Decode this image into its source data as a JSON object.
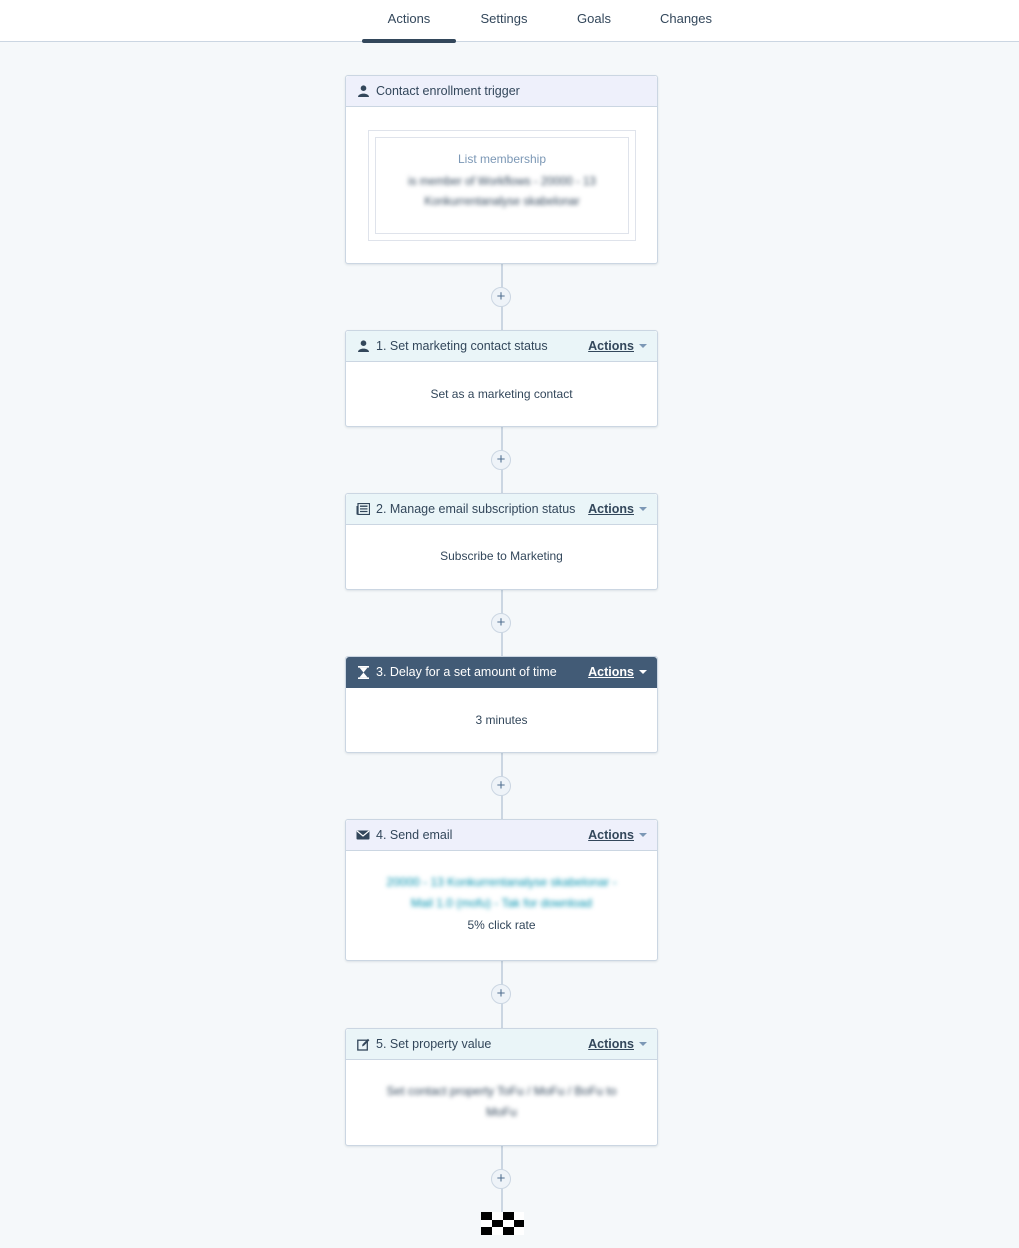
{
  "tabs": [
    "Actions",
    "Settings",
    "Goals",
    "Changes"
  ],
  "actions_label": "Actions",
  "trigger": {
    "title": "Contact enrollment trigger",
    "filter_title": "List membership",
    "filter_line1": "is member of Workflows - 20000 - 13",
    "filter_line2": "Konkurrentanalyse skabelonar"
  },
  "steps": [
    {
      "title": "1. Set marketing contact status",
      "body": "Set as a marketing contact",
      "icon": "person-icon"
    },
    {
      "title": "2. Manage email subscription status",
      "body": "Subscribe to Marketing",
      "icon": "newspaper-icon"
    },
    {
      "title": "3. Delay for a set amount of time",
      "body": "3 minutes",
      "icon": "hourglass-icon"
    },
    {
      "title": "4. Send email",
      "body_line1": "20000 - 13 Konkurrentanalyse skabelonar -",
      "body_line2": "Mail 1.0 (mofu) - Tak for download",
      "body_stat": "5% click rate",
      "icon": "envelope-icon"
    },
    {
      "title": "5. Set property value",
      "body_line1": "Set contact property ToFu / MoFu / BoFu to",
      "body_line2": "MoFu",
      "icon": "edit-icon"
    }
  ],
  "add_symbol": "+"
}
